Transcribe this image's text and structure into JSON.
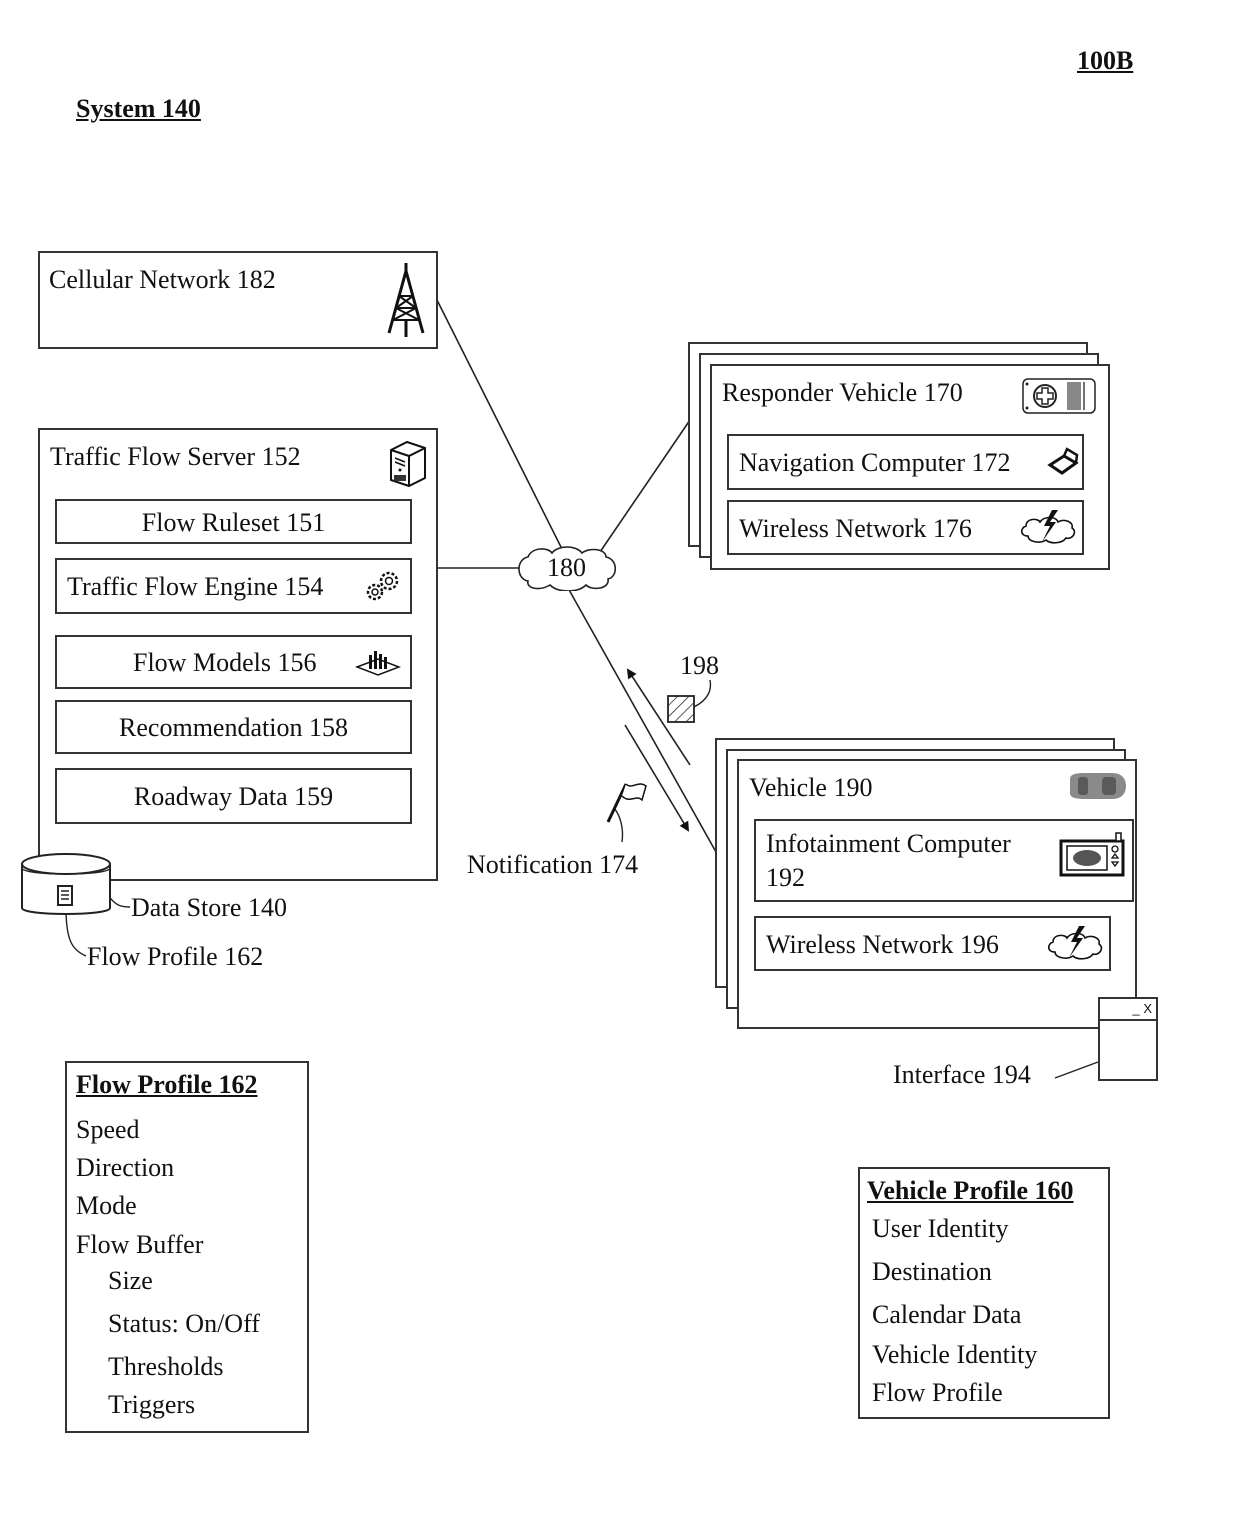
{
  "figure_label": "100B",
  "system_title": "System 140",
  "cellular_network": {
    "label": "Cellular Network 182",
    "icon": "cell-tower-icon"
  },
  "traffic_flow_server": {
    "label": "Traffic Flow Server 152",
    "icon": "server-icon",
    "modules": [
      {
        "label": "Flow Ruleset 151",
        "icon": ""
      },
      {
        "label": "Traffic Flow Engine 154",
        "icon": "gears-icon"
      },
      {
        "label": "Flow Models 156",
        "icon": "3d-chart-icon"
      },
      {
        "label": "Recommendation 158",
        "icon": ""
      },
      {
        "label": "Roadway Data 159",
        "icon": ""
      }
    ]
  },
  "data_store": {
    "label": "Data Store 140",
    "profile_label": "Flow Profile 162"
  },
  "network": {
    "label": "180"
  },
  "responder_vehicle": {
    "label": "Responder Vehicle 170",
    "icon": "ambulance-icon",
    "modules": [
      {
        "label": "Navigation Computer 172",
        "icon": "laptop-icon"
      },
      {
        "label": "Wireless Network 176",
        "icon": "wireless-cloud-icon"
      }
    ]
  },
  "vehicle": {
    "label": "Vehicle 190",
    "icon": "car-icon",
    "modules": [
      {
        "label_line1": "Infotainment Computer",
        "label_line2": "192",
        "icon": "infotainment-icon"
      },
      {
        "label": "Wireless Network 196",
        "icon": "wireless-cloud-icon"
      }
    ]
  },
  "interface": {
    "label": "Interface 194",
    "controls": "_ X"
  },
  "message_label": "198",
  "notification_label": "Notification 174",
  "flow_profile": {
    "title": "Flow Profile 162",
    "items": [
      "Speed",
      "Direction",
      "Mode",
      "Flow Buffer"
    ],
    "sub_items": [
      "Size",
      "Status: On/Off",
      "Thresholds",
      "Triggers"
    ]
  },
  "vehicle_profile": {
    "title": "Vehicle Profile 160",
    "items": [
      "User Identity",
      "Destination",
      "Calendar Data",
      "Vehicle Identity",
      "Flow Profile"
    ]
  }
}
